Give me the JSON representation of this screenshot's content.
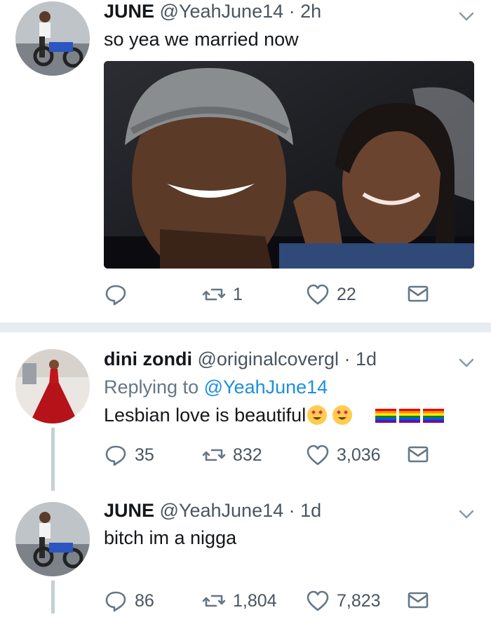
{
  "tweet1": {
    "name": "JUNE",
    "handle": "@YeahJune14",
    "separator": "·",
    "time": "2h",
    "text": "so yea we married now",
    "replies": "",
    "retweets": "1",
    "likes": "22"
  },
  "tweet2": {
    "name": "dini zondi",
    "handle": "@originalcovergl",
    "separator": "·",
    "time": "1d",
    "replying_prefix": "Replying to",
    "replying_handle": "@YeahJune14",
    "text": "Lesbian love is beautiful",
    "replies": "35",
    "retweets": "832",
    "likes": "3,036"
  },
  "tweet3": {
    "name": "JUNE",
    "handle": "@YeahJune14",
    "separator": "·",
    "time": "1d",
    "text": "bitch im a nigga",
    "replies": "86",
    "retweets": "1,804",
    "likes": "7,823"
  },
  "icons": {
    "reply": "reply-icon",
    "retweet": "retweet-icon",
    "like": "heart-icon",
    "dm": "envelope-icon",
    "more": "chevron-down-icon"
  },
  "colors": {
    "text": "#14171a",
    "secondary": "#4a5560",
    "link": "#1d8fe0",
    "divider": "#e6ecf0"
  }
}
